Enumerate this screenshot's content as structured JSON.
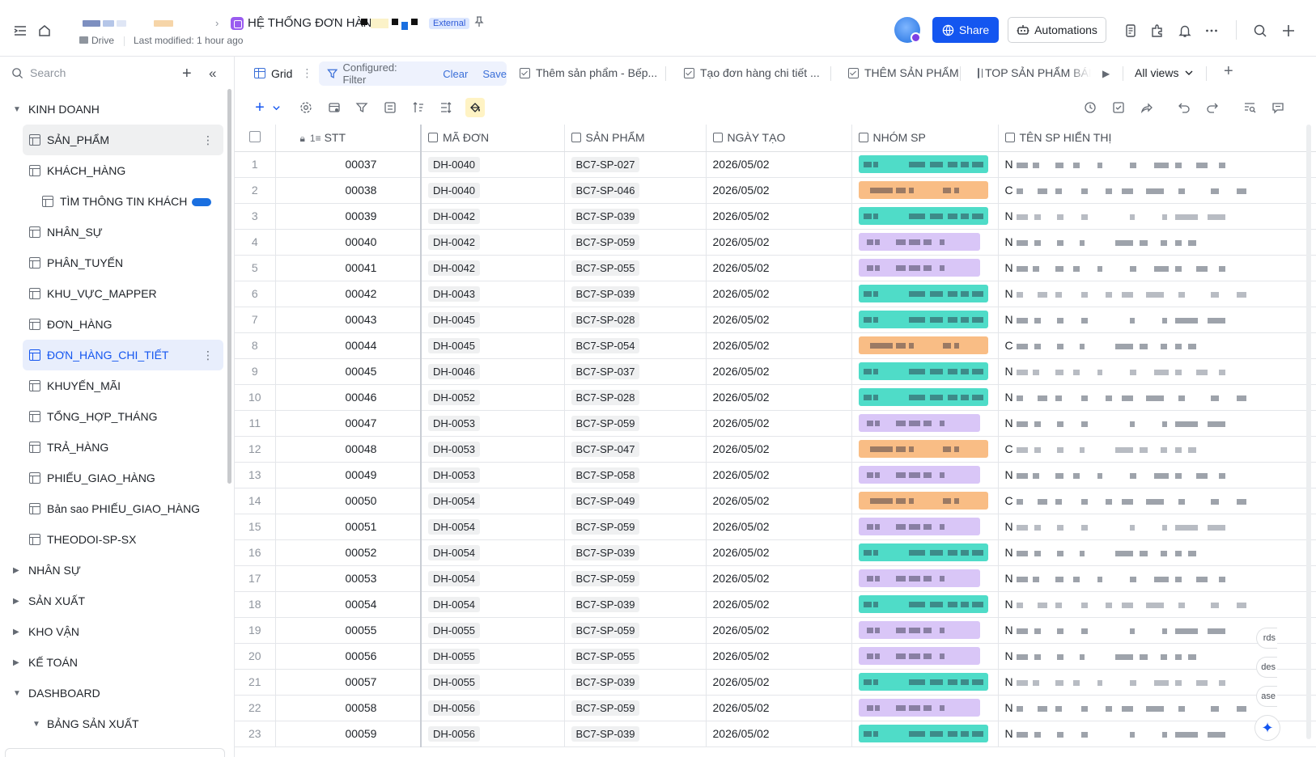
{
  "header": {
    "doc_title": "HỆ THỐNG ĐƠN HÀNG",
    "external_badge": "External",
    "drive_label": "Drive",
    "last_modified": "Last modified: 1 hour ago",
    "share_label": "Share",
    "automations_label": "Automations"
  },
  "sidebar": {
    "search_placeholder": "Search",
    "items": [
      {
        "label": "KINH DOANH",
        "kind": "group",
        "expanded": true
      },
      {
        "label": "SẢN_PHẨM",
        "kind": "leaf",
        "state": "hover"
      },
      {
        "label": "KHÁCH_HÀNG",
        "kind": "leaf"
      },
      {
        "label": "TÌM THÔNG TIN KHÁCH",
        "kind": "subleaf"
      },
      {
        "label": "NHÂN_SỰ",
        "kind": "leaf"
      },
      {
        "label": "PHÂN_TUYẾN",
        "kind": "leaf"
      },
      {
        "label": "KHU_VỰC_MAPPER",
        "kind": "leaf"
      },
      {
        "label": "ĐƠN_HÀNG",
        "kind": "leaf"
      },
      {
        "label": "ĐƠN_HÀNG_CHI_TIẾT",
        "kind": "leaf",
        "state": "selected"
      },
      {
        "label": "KHUYẾN_MÃI",
        "kind": "leaf"
      },
      {
        "label": "TỔNG_HỢP_THÁNG",
        "kind": "leaf"
      },
      {
        "label": "TRẢ_HÀNG",
        "kind": "leaf"
      },
      {
        "label": "PHIẾU_GIAO_HÀNG",
        "kind": "leaf"
      },
      {
        "label": "Bản sao PHIẾU_GIAO_HÀNG",
        "kind": "leaf"
      },
      {
        "label": "THEODOI-SP-SX",
        "kind": "leaf"
      },
      {
        "label": "NHÂN SỰ",
        "kind": "group",
        "expanded": false
      },
      {
        "label": "SẢN XUẤT",
        "kind": "group",
        "expanded": false
      },
      {
        "label": "KHO VẬN",
        "kind": "group",
        "expanded": false
      },
      {
        "label": "KẾ TOÁN",
        "kind": "group",
        "expanded": false
      },
      {
        "label": "DASHBOARD",
        "kind": "group",
        "expanded": true
      },
      {
        "label": "BẢNG SẢN XUẤT",
        "kind": "subgroup",
        "expanded": true
      }
    ]
  },
  "views": {
    "grid_label": "Grid",
    "filter_label": "Configured: Filter",
    "clear_label": "Clear",
    "save_label": "Save",
    "tabs": [
      "Thêm sản phẩm - Bếp...",
      "Tạo đơn hàng chi tiết ...",
      "THÊM SẢN PHẨM",
      "TOP SẢN PHẨM BÁN"
    ],
    "all_views_label": "All views"
  },
  "table": {
    "columns": [
      "STT",
      "MÃ ĐƠN",
      "SẢN PHẨM",
      "NGÀY TẠO",
      "NHÓM SP",
      "TÊN SP HIỂN THỊ"
    ],
    "rows": [
      {
        "n": "1",
        "stt": "00037",
        "ma_don": "DH-0040",
        "san_pham": "BC7-SP-027",
        "ngay_tao": "2026/05/02",
        "nhom": "teal",
        "ten_initial": "N"
      },
      {
        "n": "2",
        "stt": "00038",
        "ma_don": "DH-0040",
        "san_pham": "BC7-SP-046",
        "ngay_tao": "2026/05/02",
        "nhom": "orange",
        "ten_initial": "C"
      },
      {
        "n": "3",
        "stt": "00039",
        "ma_don": "DH-0042",
        "san_pham": "BC7-SP-039",
        "ngay_tao": "2026/05/02",
        "nhom": "teal",
        "ten_initial": "N"
      },
      {
        "n": "4",
        "stt": "00040",
        "ma_don": "DH-0042",
        "san_pham": "BC7-SP-059",
        "ngay_tao": "2026/05/02",
        "nhom": "purple",
        "ten_initial": "N"
      },
      {
        "n": "5",
        "stt": "00041",
        "ma_don": "DH-0042",
        "san_pham": "BC7-SP-055",
        "ngay_tao": "2026/05/02",
        "nhom": "purple",
        "ten_initial": "N"
      },
      {
        "n": "6",
        "stt": "00042",
        "ma_don": "DH-0043",
        "san_pham": "BC7-SP-039",
        "ngay_tao": "2026/05/02",
        "nhom": "teal",
        "ten_initial": "N"
      },
      {
        "n": "7",
        "stt": "00043",
        "ma_don": "DH-0045",
        "san_pham": "BC7-SP-028",
        "ngay_tao": "2026/05/02",
        "nhom": "teal",
        "ten_initial": "N"
      },
      {
        "n": "8",
        "stt": "00044",
        "ma_don": "DH-0045",
        "san_pham": "BC7-SP-054",
        "ngay_tao": "2026/05/02",
        "nhom": "orange",
        "ten_initial": "C"
      },
      {
        "n": "9",
        "stt": "00045",
        "ma_don": "DH-0046",
        "san_pham": "BC7-SP-037",
        "ngay_tao": "2026/05/02",
        "nhom": "teal",
        "ten_initial": "N"
      },
      {
        "n": "10",
        "stt": "00046",
        "ma_don": "DH-0052",
        "san_pham": "BC7-SP-028",
        "ngay_tao": "2026/05/02",
        "nhom": "teal",
        "ten_initial": "N"
      },
      {
        "n": "11",
        "stt": "00047",
        "ma_don": "DH-0053",
        "san_pham": "BC7-SP-059",
        "ngay_tao": "2026/05/02",
        "nhom": "purple",
        "ten_initial": "N"
      },
      {
        "n": "12",
        "stt": "00048",
        "ma_don": "DH-0053",
        "san_pham": "BC7-SP-047",
        "ngay_tao": "2026/05/02",
        "nhom": "orange",
        "ten_initial": "C"
      },
      {
        "n": "13",
        "stt": "00049",
        "ma_don": "DH-0053",
        "san_pham": "BC7-SP-058",
        "ngay_tao": "2026/05/02",
        "nhom": "purple",
        "ten_initial": "N"
      },
      {
        "n": "14",
        "stt": "00050",
        "ma_don": "DH-0054",
        "san_pham": "BC7-SP-049",
        "ngay_tao": "2026/05/02",
        "nhom": "orange",
        "ten_initial": "C"
      },
      {
        "n": "15",
        "stt": "00051",
        "ma_don": "DH-0054",
        "san_pham": "BC7-SP-059",
        "ngay_tao": "2026/05/02",
        "nhom": "purple",
        "ten_initial": "N"
      },
      {
        "n": "16",
        "stt": "00052",
        "ma_don": "DH-0054",
        "san_pham": "BC7-SP-039",
        "ngay_tao": "2026/05/02",
        "nhom": "teal",
        "ten_initial": "N"
      },
      {
        "n": "17",
        "stt": "00053",
        "ma_don": "DH-0054",
        "san_pham": "BC7-SP-059",
        "ngay_tao": "2026/05/02",
        "nhom": "purple",
        "ten_initial": "N"
      },
      {
        "n": "18",
        "stt": "00054",
        "ma_don": "DH-0054",
        "san_pham": "BC7-SP-039",
        "ngay_tao": "2026/05/02",
        "nhom": "teal",
        "ten_initial": "N"
      },
      {
        "n": "19",
        "stt": "00055",
        "ma_don": "DH-0055",
        "san_pham": "BC7-SP-059",
        "ngay_tao": "2026/05/02",
        "nhom": "purple",
        "ten_initial": "N"
      },
      {
        "n": "20",
        "stt": "00056",
        "ma_don": "DH-0055",
        "san_pham": "BC7-SP-055",
        "ngay_tao": "2026/05/02",
        "nhom": "purple",
        "ten_initial": "N"
      },
      {
        "n": "21",
        "stt": "00057",
        "ma_don": "DH-0055",
        "san_pham": "BC7-SP-039",
        "ngay_tao": "2026/05/02",
        "nhom": "teal",
        "ten_initial": "N"
      },
      {
        "n": "22",
        "stt": "00058",
        "ma_don": "DH-0056",
        "san_pham": "BC7-SP-059",
        "ngay_tao": "2026/05/02",
        "nhom": "purple",
        "ten_initial": "N"
      },
      {
        "n": "23",
        "stt": "00059",
        "ma_don": "DH-0056",
        "san_pham": "BC7-SP-039",
        "ngay_tao": "2026/05/02",
        "nhom": "teal",
        "ten_initial": "N"
      }
    ]
  },
  "floaters": [
    "rds",
    "des",
    "ase"
  ],
  "colors": {
    "accent": "#1456f0",
    "teal": "#4fdcc8",
    "orange": "#f9bd85",
    "purple": "#d9c6f7"
  }
}
